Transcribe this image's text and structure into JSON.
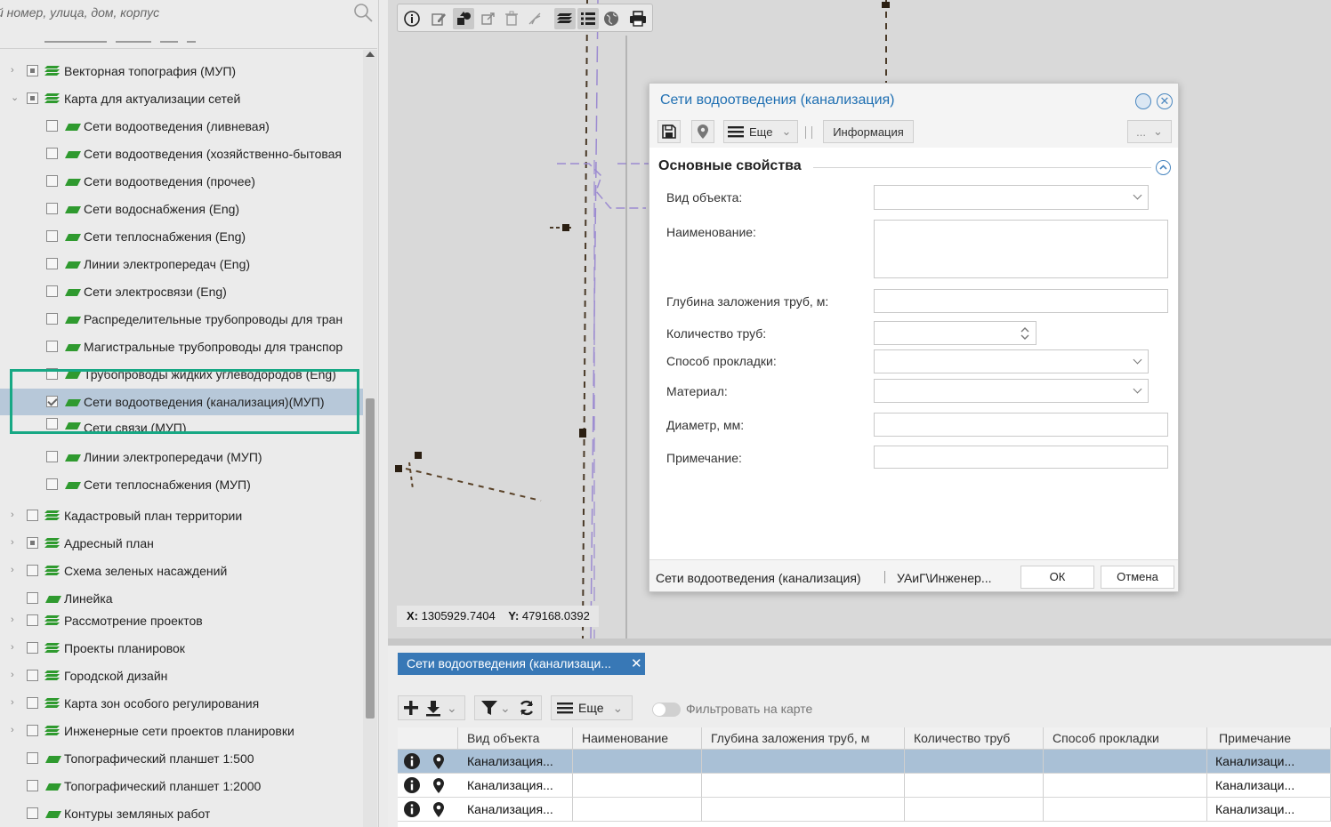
{
  "search": {
    "placeholder": "й номер, улица, дом, корпус"
  },
  "tree": {
    "items": [
      {
        "label": "Векторная топография (МУП)"
      },
      {
        "label": "Карта для актуализации сетей"
      },
      {
        "label": "Сети водоотведения (ливневая)"
      },
      {
        "label": "Сети водоотведения (хозяйственно-бытовая"
      },
      {
        "label": "Сети водоотведения (прочее)"
      },
      {
        "label": "Сети водоснабжения (Eng)"
      },
      {
        "label": "Сети теплоснабжения (Eng)"
      },
      {
        "label": "Линии электропередач (Eng)"
      },
      {
        "label": "Сети электросвязи (Eng)"
      },
      {
        "label": "Распределительные трубопроводы для тран"
      },
      {
        "label": "Магистральные трубопроводы для транспор"
      },
      {
        "label": "Трубопроводы жидких углеводородов (Eng)"
      },
      {
        "label": "Сети водоотведения (канализация)(МУП)"
      },
      {
        "label": "Сети связи (МУП)"
      },
      {
        "label": "Линии электропередачи (МУП)"
      },
      {
        "label": "Сети теплоснабжения (МУП)"
      },
      {
        "label": "Кадастровый план территории"
      },
      {
        "label": "Адресный план"
      },
      {
        "label": "Схема зеленых насаждений"
      },
      {
        "label": "Линейка"
      },
      {
        "label": "Рассмотрение проектов"
      },
      {
        "label": "Проекты планировок"
      },
      {
        "label": "Городской дизайн"
      },
      {
        "label": "Карта зон особого регулирования"
      },
      {
        "label": "Инженерные сети проектов планировки"
      },
      {
        "label": "Топографический планшет 1:500"
      },
      {
        "label": "Топографический планшет 1:2000"
      },
      {
        "label": "Контуры земляных работ"
      }
    ]
  },
  "map": {
    "coord_x_label": "X:",
    "coord_x": "1305929.7404",
    "coord_y_label": "Y:",
    "coord_y": "479168.0392"
  },
  "dialog": {
    "title": "Сети водоотведения (канализация)",
    "more_label": "Еще",
    "info_tab": "Информация",
    "dots_label": "...",
    "section_title": "Основные свойства",
    "fields": {
      "type": "Вид объекта:",
      "name": "Наименование:",
      "depth": "Глубина заложения труб, м:",
      "count": "Количество труб:",
      "method": "Способ прокладки:",
      "material": "Материал:",
      "diameter": "Диаметр, мм:",
      "note": "Примечание:"
    },
    "footer_left": "Сети водоотведения (канализация)",
    "footer_mid": "УАиГ\\Инженер...",
    "ok": "ОК",
    "cancel": "Отмена"
  },
  "bottom": {
    "tab_label": "Сети водоотведения (канализаци...",
    "more_label": "Еще",
    "filter_toggle": "Фильтровать на карте",
    "columns": [
      "Вид объекта",
      "Наименование",
      "Глубина заложения труб, м",
      "Количество труб",
      "Способ прокладки",
      "Примечание"
    ],
    "rows": [
      {
        "type": "Канализация...",
        "note": "Канализаци..."
      },
      {
        "type": "Канализация...",
        "note": "Канализаци..."
      },
      {
        "type": "Канализация...",
        "note": "Канализаци..."
      }
    ]
  },
  "colors": {
    "accent": "#1f6fb2",
    "highlight": "#17a884",
    "layer_green": "#2f9a2f"
  }
}
